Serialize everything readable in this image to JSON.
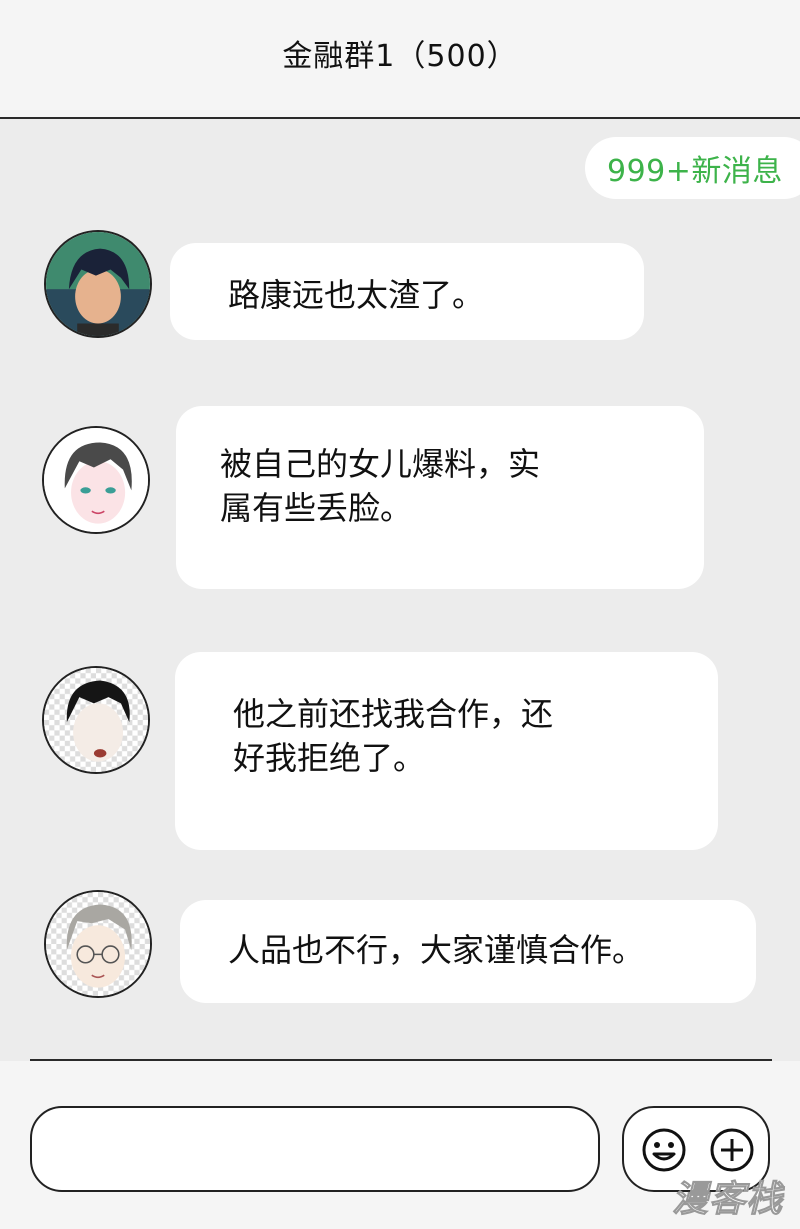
{
  "header": {
    "title": "金融群1（500）"
  },
  "new_messages": {
    "label": "999+新消息",
    "color": "#3db34a"
  },
  "messages": [
    {
      "avatar": "avatar-dark-hair-man",
      "lines": [
        "路康远也太渣了。"
      ]
    },
    {
      "avatar": "avatar-green-eyed-man",
      "lines": [
        "被自己的女儿爆料，实",
        "属有些丢脸。"
      ]
    },
    {
      "avatar": "avatar-black-hair-man-shouting",
      "lines": [
        "他之前还找我合作，还",
        "好我拒绝了。"
      ]
    },
    {
      "avatar": "avatar-grey-hair-glasses-man",
      "lines": [
        "人品也不行，大家谨慎合作。"
      ]
    }
  ],
  "composer": {
    "input_value": "",
    "emoji_icon": "smiley-icon",
    "plus_icon": "plus-icon"
  },
  "watermark": {
    "text": "漫客栈"
  }
}
